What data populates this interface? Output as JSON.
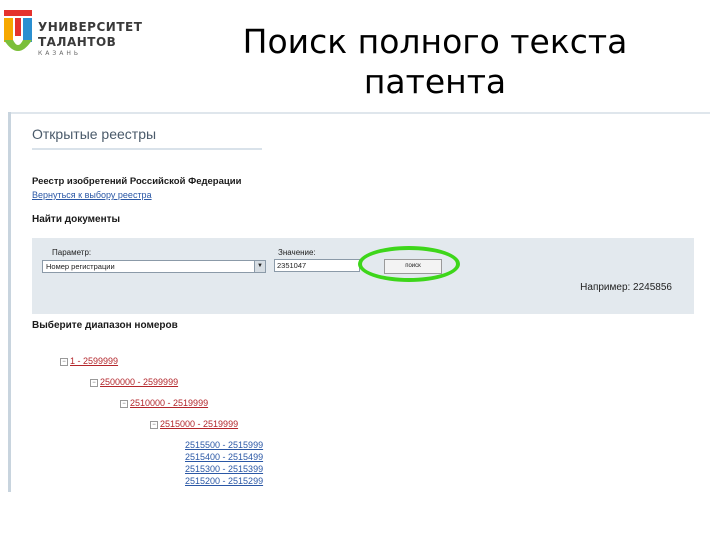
{
  "logo": {
    "line1": "УНИВЕРСИТЕТ",
    "line2": "ТАЛАНТОВ",
    "line3": "КАЗАНЬ",
    "colors": [
      "#e5322d",
      "#f6a800",
      "#2b8fd0",
      "#7bbf3a"
    ]
  },
  "slide": {
    "title_line1": "Поиск полного текста",
    "title_line2": "патента"
  },
  "app": {
    "header_title": "Открытые реестры",
    "registry_title": "Реестр изобретений Российской Федерации",
    "back_link": "Вернуться к выбору реестра",
    "find_documents": "Найти документы",
    "search": {
      "param_label": "Параметр:",
      "param_value": "Номер регистрации",
      "value_label": "Значение:",
      "value_input": "2351047",
      "button_label": "поиск",
      "example": "Например: 2245856"
    },
    "ranges_title": "Выберите диапазон номеров",
    "tree": [
      {
        "label": "1 - 2599999"
      },
      {
        "label": "2500000 - 2599999"
      },
      {
        "label": "2510000 - 2519999"
      },
      {
        "label": "2515000 - 2519999"
      }
    ],
    "leaves": [
      {
        "label": "2515500 - 2515999"
      },
      {
        "label": "2515400 - 2515499"
      },
      {
        "label": "2515300 - 2515399"
      },
      {
        "label": "2515200 - 2515299"
      }
    ],
    "colors": {
      "highlight": "#3dd61a",
      "link": "#2a57a5",
      "tree_link": "#b3262b",
      "search_bg": "#e3e9ee"
    }
  }
}
